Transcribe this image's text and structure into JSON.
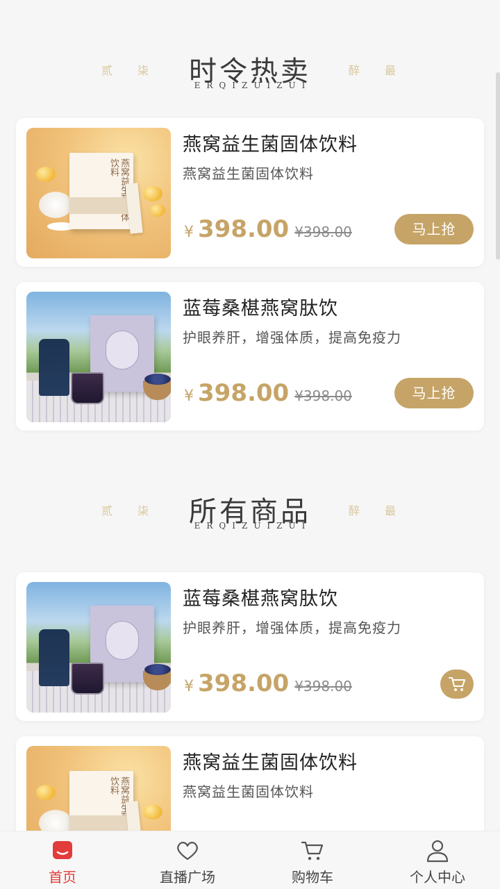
{
  "sections": [
    {
      "title": "时令热卖",
      "subtitle": "ERQIZUIZUI",
      "deco_left": "贰柒",
      "deco_right": "醉最",
      "products": [
        {
          "name": "燕窝益生菌固体饮料",
          "desc": "燕窝益生菌固体饮料",
          "currency": "¥",
          "price": "398.00",
          "original_price": "¥398.00",
          "action_label": "马上抢",
          "image": "gold"
        },
        {
          "name": "蓝莓桑椹燕窝肽饮",
          "desc": "护眼养肝，增强体质，提高免疫力",
          "currency": "¥",
          "price": "398.00",
          "original_price": "¥398.00",
          "action_label": "马上抢",
          "image": "berry"
        }
      ]
    },
    {
      "title": "所有商品",
      "subtitle": "ERQIZUIZUI",
      "deco_left": "贰柒",
      "deco_right": "醉最",
      "products": [
        {
          "name": "蓝莓桑椹燕窝肽饮",
          "desc": "护眼养肝，增强体质，提高免疫力",
          "currency": "¥",
          "price": "398.00",
          "original_price": "¥398.00",
          "action_icon": "cart-icon",
          "image": "berry"
        },
        {
          "name": "燕窝益生菌固体饮料",
          "desc": "燕窝益生菌固体饮料",
          "image": "gold"
        }
      ]
    }
  ],
  "tabbar": [
    {
      "label": "首页",
      "icon": "home-icon",
      "active": true
    },
    {
      "label": "直播广场",
      "icon": "heart-icon",
      "active": false
    },
    {
      "label": "购物车",
      "icon": "cart-icon",
      "active": false
    },
    {
      "label": "个人中心",
      "icon": "user-icon",
      "active": false
    }
  ],
  "colors": {
    "accent": "#c6a467",
    "active_tab": "#e23b3b",
    "background": "#f6f6f6"
  }
}
